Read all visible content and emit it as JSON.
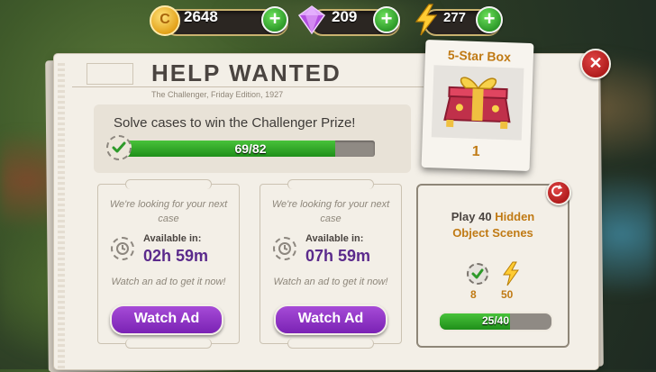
{
  "currencies": {
    "coins": "2648",
    "gems": "209",
    "energy": "277"
  },
  "panel": {
    "title": "HELP WANTED",
    "edition": "The Challenger, Friday Edition, 1927"
  },
  "progress": {
    "heading": "Solve cases to win the Challenger Prize!",
    "text": "69/82",
    "current": 69,
    "total": 82
  },
  "reward_box": {
    "title": "5-Star Box",
    "count": "1"
  },
  "cases": [
    {
      "looking": "We're looking for your next case",
      "available_label": "Available in:",
      "timer": "02h 59m",
      "watch_hint": "Watch an ad to get it now!",
      "button": "Watch Ad"
    },
    {
      "looking": "We're looking for your next case",
      "available_label": "Available in:",
      "timer": "07h 59m",
      "watch_hint": "Watch an ad to get it now!",
      "button": "Watch Ad"
    }
  ],
  "task": {
    "prefix": "Play 40",
    "highlight_1": "Hidden",
    "highlight_2": "Object Scenes",
    "reward_1": "8",
    "reward_2": "50",
    "progress_text": "25/40",
    "current": 25,
    "total": 40
  },
  "colors": {
    "accent": "#c07a14",
    "purple": "#7a22b4",
    "green": "#2e9a2a",
    "close_red": "#b01c1c"
  },
  "icons": [
    "coin-icon",
    "gem-icon",
    "bolt-icon",
    "plus-icon",
    "close-icon",
    "check-icon",
    "clock-icon",
    "refresh-icon",
    "chest-icon"
  ]
}
